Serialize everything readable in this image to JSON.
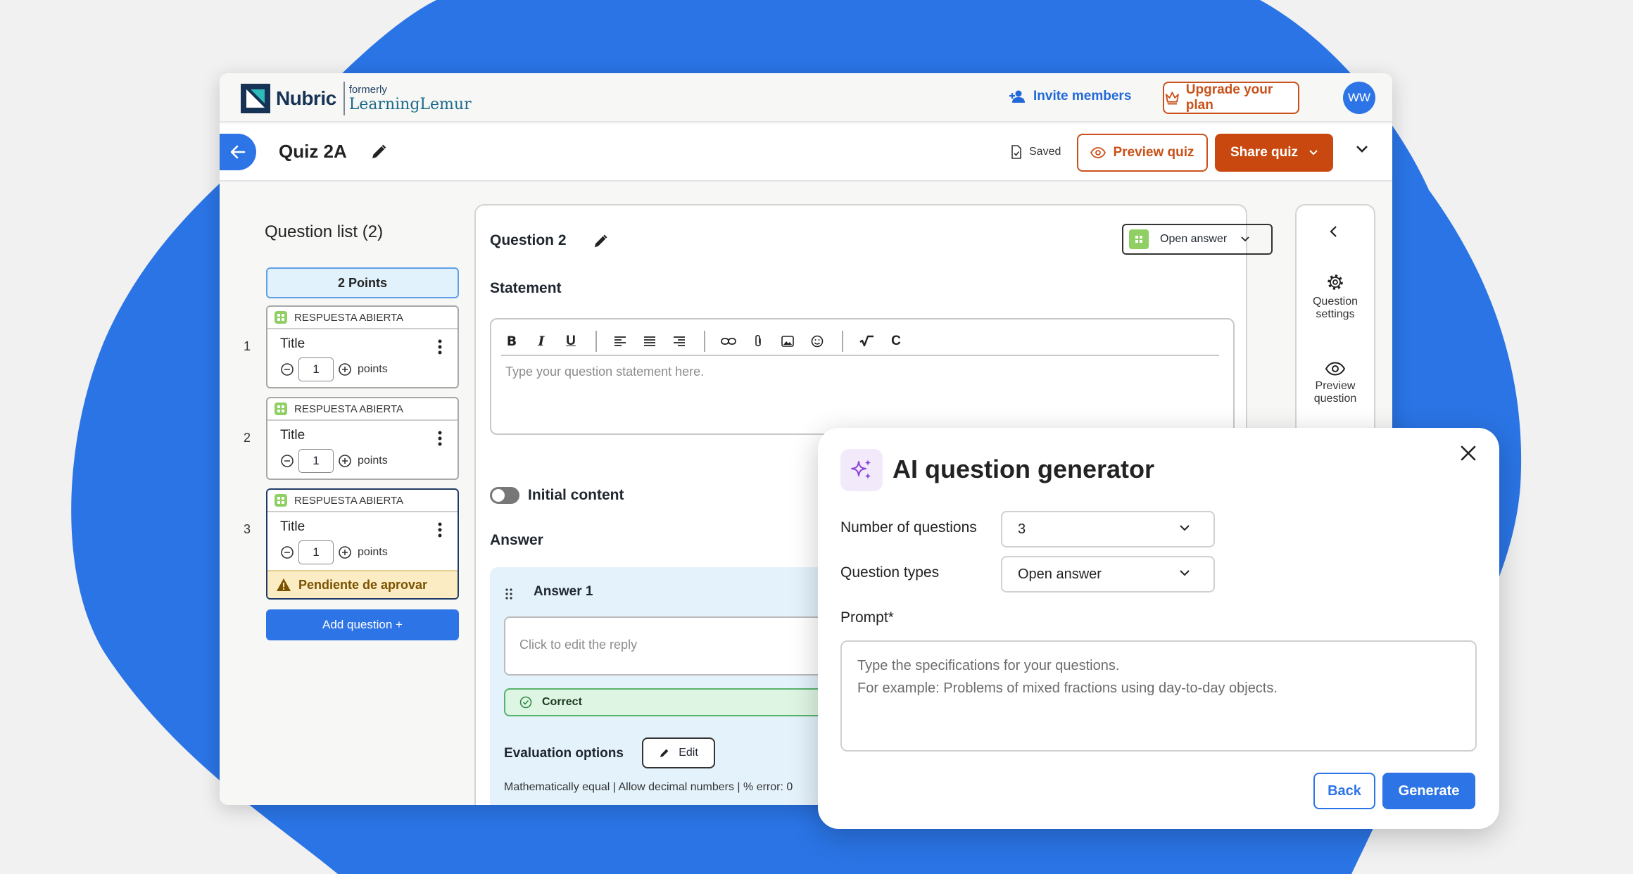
{
  "colors": {
    "blob": "#2a74e5",
    "primary": "#2d74e6",
    "orange": "#c9480f",
    "pending_bg": "#fbecc4",
    "correct_bg": "#dff5e3"
  },
  "header": {
    "logo_name": "Nubric",
    "logo_formerly": "formerly",
    "logo_old_name": "LearningLemur",
    "invite_label": "Invite members",
    "upgrade_label": "Upgrade your plan",
    "avatar_initials": "WW"
  },
  "quizbar": {
    "title": "Quiz 2A",
    "saved_label": "Saved",
    "preview_label": "Preview quiz",
    "share_label": "Share quiz"
  },
  "question_list": {
    "title": "Question list (2)",
    "points_banner": "2 Points",
    "items": [
      {
        "number": "1",
        "type_label": "RESPUESTA ABIERTA",
        "title": "Title",
        "points_value": "1",
        "points_label": "points"
      },
      {
        "number": "2",
        "type_label": "RESPUESTA ABIERTA",
        "title": "Title",
        "points_value": "1",
        "points_label": "points"
      },
      {
        "number": "3",
        "type_label": "RESPUESTA ABIERTA",
        "title": "Title",
        "points_value": "1",
        "points_label": "points",
        "status": "Pendiente de aprovar"
      }
    ],
    "add_label": "Add question +"
  },
  "editor": {
    "question_title": "Question 2",
    "type_select": "Open answer",
    "statement_label": "Statement",
    "statement_placeholder": "Type your question statement here.",
    "toolbar": [
      "bold-icon",
      "italic-icon",
      "underline-icon",
      "align-left-icon",
      "align-center-icon",
      "align-right-icon",
      "link-icon",
      "attach-icon",
      "image-icon",
      "emoji-icon",
      "formula-icon",
      "clear-icon"
    ],
    "initial_content_label": "Initial content",
    "answer_label": "Answer",
    "answer1_label": "Answer 1",
    "answer1_placeholder": "Click to edit the reply",
    "correct_label": "Correct",
    "eval_label": "Evaluation options",
    "edit_label": "Edit",
    "eval_options": "Mathematically equal  |  Allow decimal numbers  |  % error: 0"
  },
  "rail": {
    "settings_label": "Question settings",
    "preview_label": "Preview question"
  },
  "modal": {
    "title": "AI question generator",
    "num_label": "Number of questions",
    "num_value": "3",
    "types_label": "Question types",
    "types_value": "Open answer",
    "prompt_label": "Prompt*",
    "prompt_placeholder_line1": "Type the specifications for your questions.",
    "prompt_placeholder_line2": "For example: Problems of mixed fractions using day-to-day objects.",
    "back_label": "Back",
    "generate_label": "Generate"
  }
}
